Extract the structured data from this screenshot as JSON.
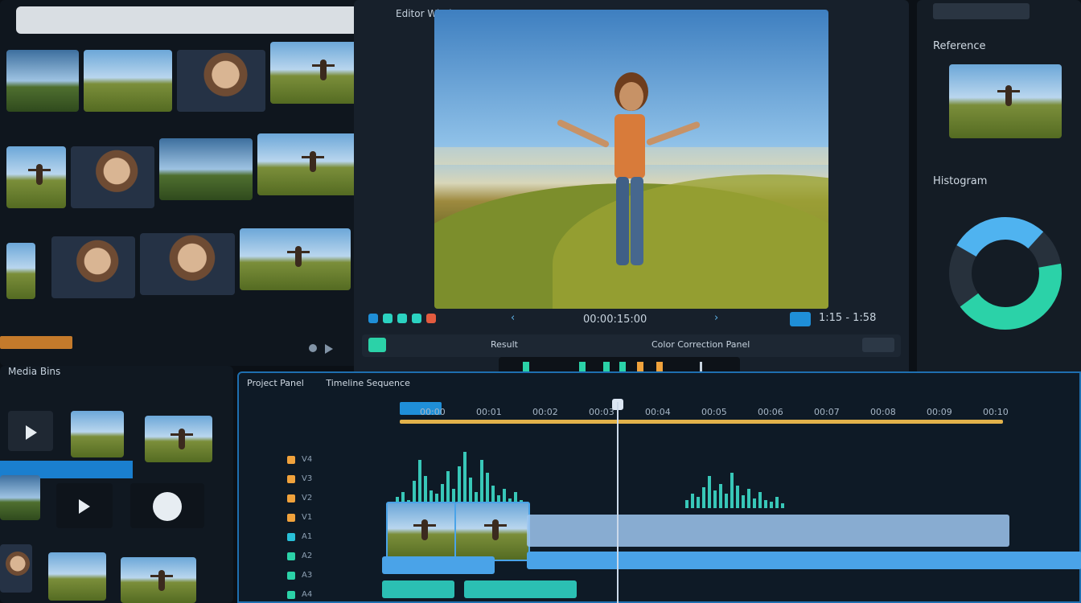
{
  "preview": {
    "title": "Editor Window",
    "timecode": "00:00:15:00",
    "counter": "1:15 - 1:58",
    "subbar_left": "Result",
    "subbar_mid": "Color Correction Panel"
  },
  "inspector": {
    "section1": "Reference",
    "section2": "Histogram"
  },
  "timeline": {
    "header": "Project Panel",
    "sequence": "Timeline Sequence",
    "ruler": [
      "00:00",
      "00:01",
      "00:02",
      "00:03",
      "00:04",
      "00:05",
      "00:06",
      "00:07",
      "00:08",
      "00:09",
      "00:10"
    ],
    "tracks": [
      {
        "label": "V4",
        "color": "#f0a23c"
      },
      {
        "label": "V3",
        "color": "#f0a23c"
      },
      {
        "label": "V2",
        "color": "#f0a23c"
      },
      {
        "label": "V1",
        "color": "#f0a23c"
      },
      {
        "label": "A1",
        "color": "#28c0d8"
      },
      {
        "label": "A2",
        "color": "#2bd2a8"
      },
      {
        "label": "A3",
        "color": "#2bd2a8"
      },
      {
        "label": "A4",
        "color": "#2bd2a8"
      }
    ]
  },
  "bins": {
    "title": "Media Bins"
  },
  "colors": {
    "accent": "#1f8fd8",
    "teal": "#2bd2c1",
    "gold": "#e2b24b"
  }
}
